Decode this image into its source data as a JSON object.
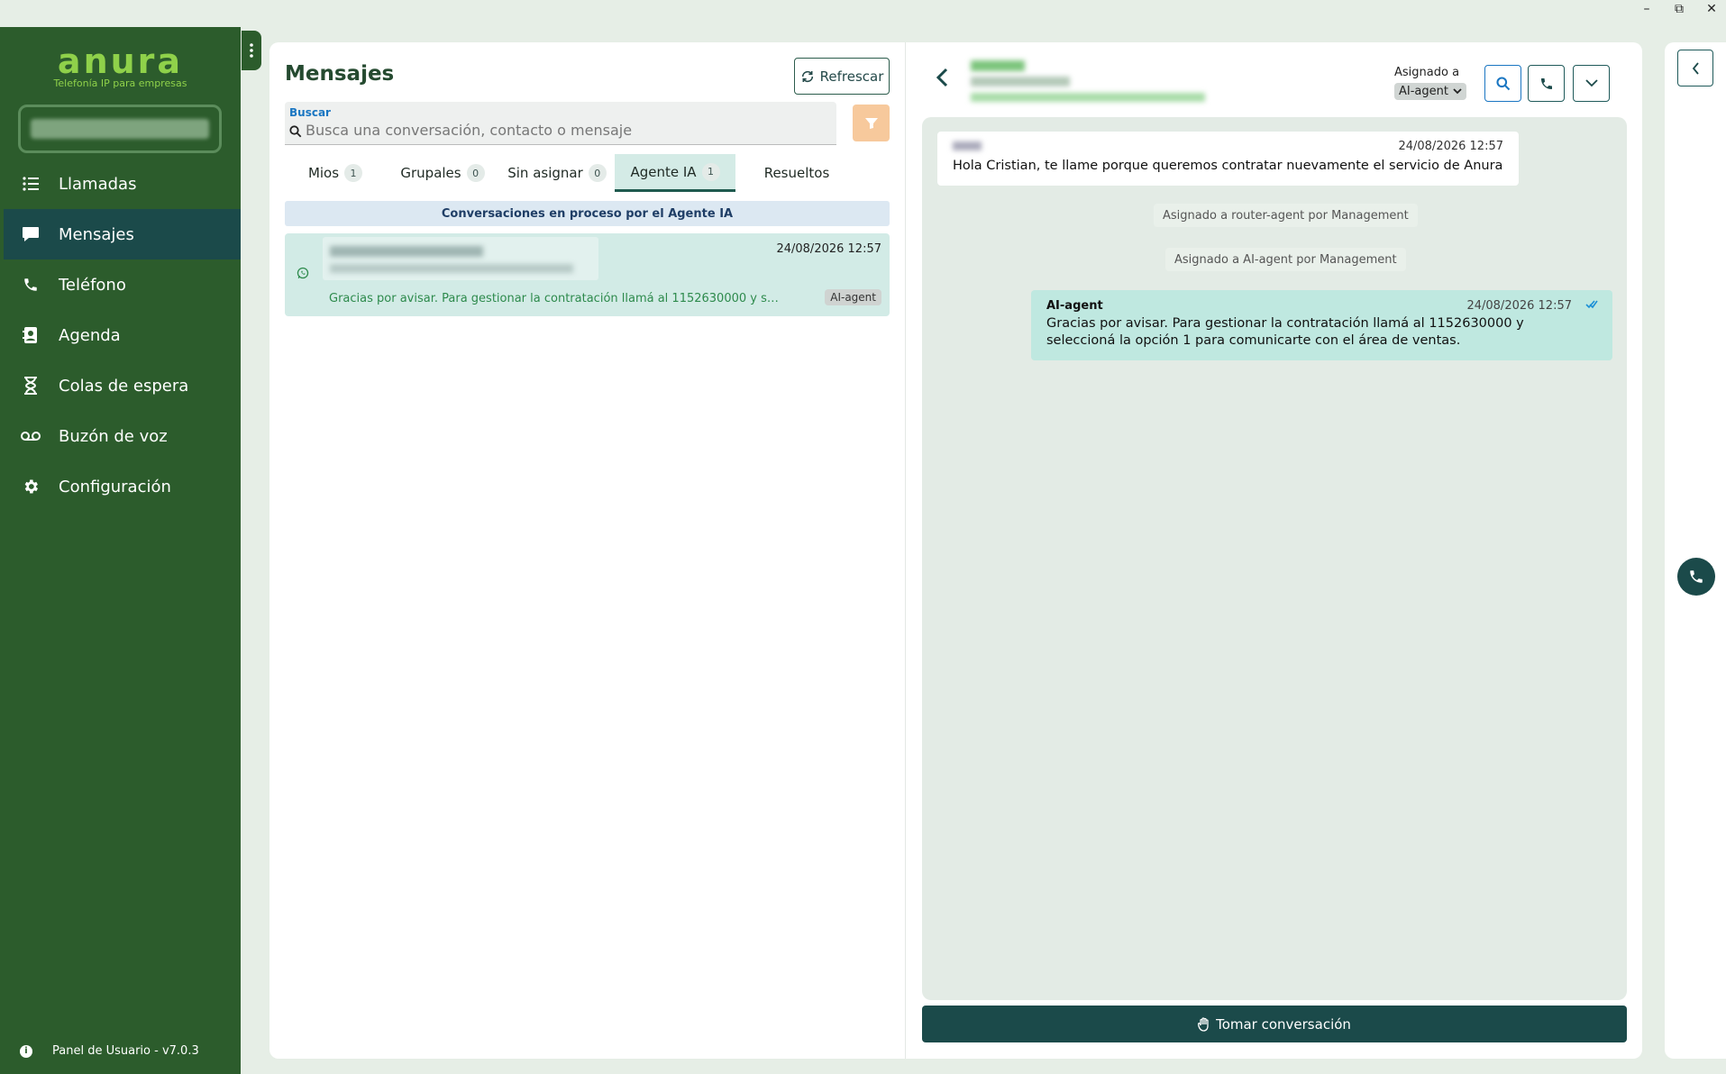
{
  "window": {
    "minimize": "–",
    "maximize": "⧉",
    "close": "✕"
  },
  "brand": {
    "logo": "anura",
    "tagline": "Telefonía IP para empresas",
    "color": "#8fd14a"
  },
  "sidebar": {
    "items": [
      {
        "label": "Llamadas",
        "icon": "list-icon"
      },
      {
        "label": "Mensajes",
        "icon": "chat-icon",
        "active": true
      },
      {
        "label": "Teléfono",
        "icon": "phone-icon"
      },
      {
        "label": "Agenda",
        "icon": "contact-book-icon"
      },
      {
        "label": "Colas de espera",
        "icon": "hourglass-icon"
      },
      {
        "label": "Buzón de voz",
        "icon": "voicemail-icon"
      },
      {
        "label": "Configuración",
        "icon": "gear-icon"
      }
    ],
    "footer": "Panel de Usuario - v7.0.3"
  },
  "list": {
    "title": "Mensajes",
    "refresh_label": "Refrescar",
    "search": {
      "label": "Buscar",
      "placeholder": "Busca una conversación, contacto o mensaje"
    },
    "tabs": [
      {
        "label": "Mios",
        "count": "1"
      },
      {
        "label": "Grupales",
        "count": "0"
      },
      {
        "label": "Sin asignar",
        "count": "0"
      },
      {
        "label": "Agente IA",
        "count": "1",
        "active": true
      },
      {
        "label": "Resueltos"
      }
    ],
    "banner": "Conversaciones en proceso por el Agente IA",
    "conversations": [
      {
        "date": "24/08/2026 12:57",
        "snippet": "Gracias por avisar. Para gestionar la contratación llamá al 1152630000 y seleccioná la opción 1 para comunicarte con el área de ventas.",
        "badge": "AI-agent",
        "channel_icon": "whatsapp-icon"
      }
    ]
  },
  "chat": {
    "assigned_label": "Asignado a",
    "assigned_value": "AI-agent",
    "messages": {
      "incoming": {
        "time": "24/08/2026 12:57",
        "text": "Hola Cristian, te llame porque queremos contratar nuevamente el servicio de Anura"
      },
      "system": [
        "Asignado a router-agent por Management",
        "Asignado a AI-agent por Management"
      ],
      "outgoing": {
        "author": "AI-agent",
        "time": "24/08/2026 12:57",
        "text": "Gracias por avisar. Para gestionar la contratación llamá al 1152630000 y seleccioná la opción 1 para comunicarte con el área de ventas."
      }
    },
    "take_label": "Tomar conversación"
  },
  "colors": {
    "sidebar": "#2c5c2c",
    "accent_dark": "#1b4a4a",
    "active_tab": "#d4ebe6",
    "outgoing_bubble": "#bfe8e0"
  }
}
